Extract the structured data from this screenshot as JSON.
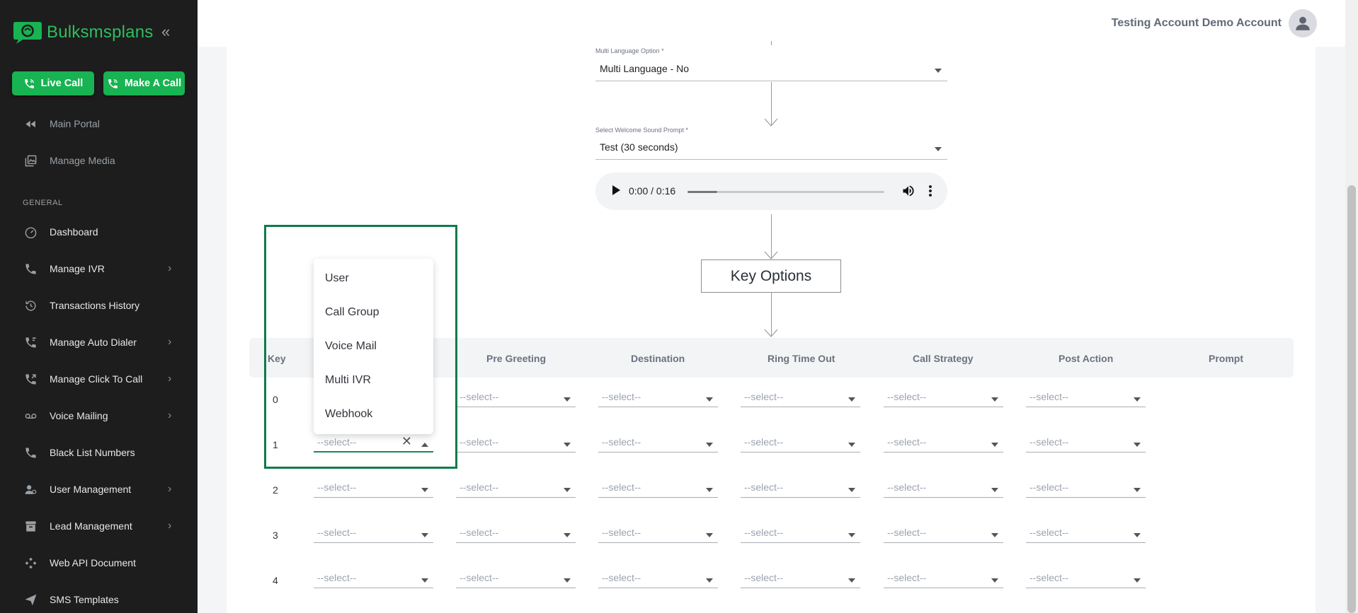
{
  "brand": {
    "name": "Bulksmsplans"
  },
  "sidebar": {
    "buttons": {
      "live_call": "Live Call",
      "make_call": "Make A Call"
    },
    "top_items": [
      {
        "label": "Main Portal",
        "icon": "rewind-icon"
      },
      {
        "label": "Manage Media",
        "icon": "media-icon"
      }
    ],
    "section_label": "GENERAL",
    "items": [
      {
        "label": "Dashboard",
        "icon": "gauge-icon",
        "has_children": false
      },
      {
        "label": "Manage IVR",
        "icon": "phone-icon",
        "has_children": true
      },
      {
        "label": "Transactions History",
        "icon": "history-icon",
        "has_children": false
      },
      {
        "label": "Manage Auto Dialer",
        "icon": "auto-dialer-icon",
        "has_children": true
      },
      {
        "label": "Manage Click To Call",
        "icon": "click-to-call-icon",
        "has_children": true
      },
      {
        "label": "Voice Mailing",
        "icon": "voicemail-icon",
        "has_children": true
      },
      {
        "label": "Black List Numbers",
        "icon": "phone-icon",
        "has_children": false
      },
      {
        "label": "User Management",
        "icon": "users-icon",
        "has_children": true
      },
      {
        "label": "Lead Management",
        "icon": "archive-icon",
        "has_children": true
      },
      {
        "label": "Web API Document",
        "icon": "api-icon",
        "has_children": false
      },
      {
        "label": "SMS Templates",
        "icon": "send-icon",
        "has_children": false
      }
    ]
  },
  "header": {
    "user_name": "Testing Account Demo Account"
  },
  "form": {
    "multi_language": {
      "label": "Multi Language Option *",
      "value": "Multi Language - No"
    },
    "welcome_prompt": {
      "label": "Select Welcome Sound Prompt *",
      "value": "Test (30 seconds)"
    },
    "audio": {
      "time": "0:00 / 0:16",
      "progress": 0.15
    },
    "key_options_title": "Key Options"
  },
  "table": {
    "headers": [
      "Key",
      "Pre Greeting",
      "Destination",
      "Ring Time Out",
      "Call Strategy",
      "Post Action",
      "Prompt"
    ],
    "placeholder": "--select--",
    "rows": [
      {
        "key": "0"
      },
      {
        "key": "1"
      },
      {
        "key": "2"
      },
      {
        "key": "3"
      },
      {
        "key": "4"
      }
    ]
  },
  "dropdown": {
    "options": [
      "User",
      "Call Group",
      "Voice Mail",
      "Multi IVR",
      "Webhook"
    ]
  },
  "colors": {
    "brand_green": "#18b352",
    "highlight": "#0f7b4c",
    "sidebar_bg": "#1d1d1d"
  }
}
